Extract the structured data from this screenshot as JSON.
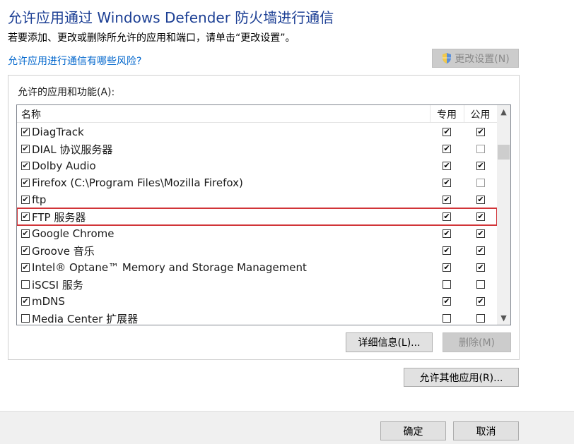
{
  "header": {
    "title": "允许应用通过 Windows Defender 防火墙进行通信",
    "subtitle": "若要添加、更改或删除所允许的应用和端口，请单击“更改设置”。",
    "risk_link": "允许应用进行通信有哪些风险?",
    "change_settings_label": "更改设置(N)"
  },
  "group": {
    "label": "允许的应用和功能(A):",
    "columns": {
      "name": "名称",
      "private": "专用",
      "public": "公用"
    },
    "rows": [
      {
        "name": "DiagTrack",
        "enabled": true,
        "private": true,
        "public": true
      },
      {
        "name": "DIAL 协议服务器",
        "enabled": true,
        "private": true,
        "public": false
      },
      {
        "name": "Dolby Audio",
        "enabled": true,
        "private": true,
        "public": true
      },
      {
        "name": "Firefox (C:\\Program Files\\Mozilla Firefox)",
        "enabled": true,
        "private": true,
        "public": false
      },
      {
        "name": "ftp",
        "enabled": true,
        "private": true,
        "public": true
      },
      {
        "name": "FTP 服务器",
        "enabled": true,
        "private": true,
        "public": true
      },
      {
        "name": "Google Chrome",
        "enabled": true,
        "private": true,
        "public": true
      },
      {
        "name": "Groove 音乐",
        "enabled": true,
        "private": true,
        "public": true
      },
      {
        "name": "Intel® Optane™ Memory and Storage Management",
        "enabled": true,
        "private": true,
        "public": true
      },
      {
        "name": "iSCSI 服务",
        "enabled": false,
        "private": false,
        "public": false
      },
      {
        "name": "mDNS",
        "enabled": true,
        "private": true,
        "public": true
      },
      {
        "name": "Media Center 扩展器",
        "enabled": false,
        "private": false,
        "public": false
      }
    ],
    "highlighted_row": "FTP 服务器",
    "details_label": "详细信息(L)...",
    "delete_label": "删除(M)"
  },
  "allow_other_label": "允许其他应用(R)...",
  "footer": {
    "ok_label": "确定",
    "cancel_label": "取消"
  },
  "colors": {
    "title": "#1c3f94",
    "link": "#0066cc",
    "highlight": "#d13438"
  }
}
